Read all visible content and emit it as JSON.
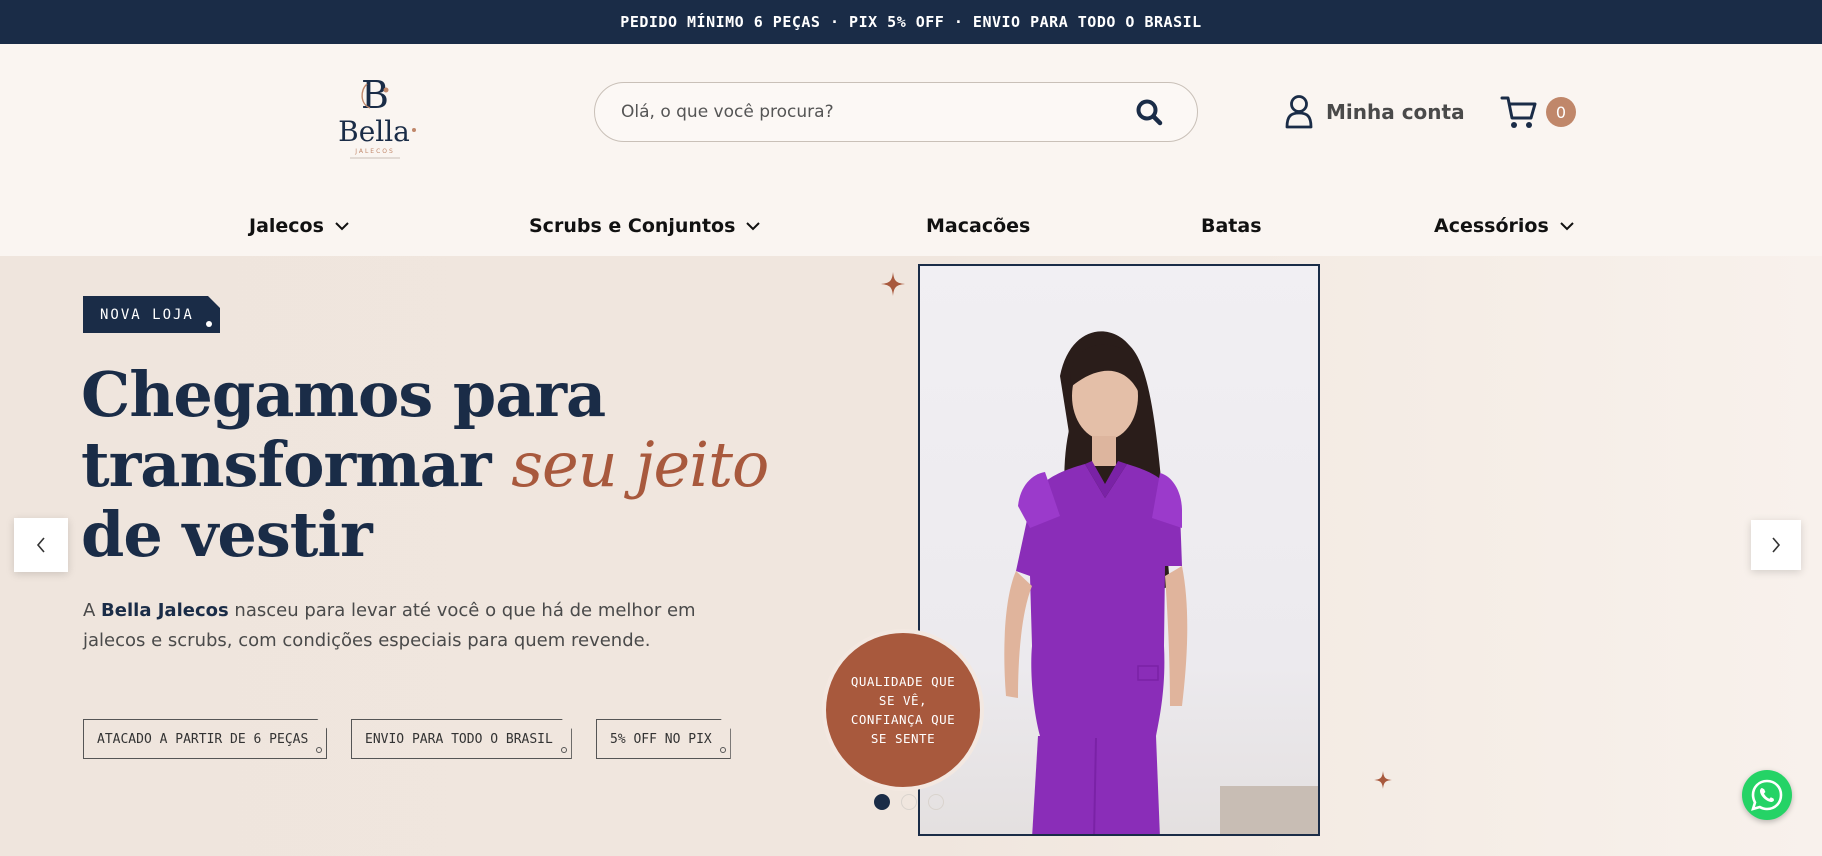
{
  "topbar": {
    "text": "PEDIDO MÍNIMO 6 PEÇAS · PIX 5% OFF · ENVIO PARA TODO O BRASIL"
  },
  "header": {
    "logo": {
      "name": "Bella",
      "sub": "JALECOS"
    },
    "search": {
      "placeholder": "Olá, o que você procura?"
    },
    "account_label": "Minha conta",
    "cart_count": "0"
  },
  "nav": {
    "items": [
      {
        "label": "Jalecos",
        "dropdown": true
      },
      {
        "label": "Scrubs e Conjuntos",
        "dropdown": true
      },
      {
        "label": "Macacões",
        "dropdown": false
      },
      {
        "label": "Batas",
        "dropdown": false
      },
      {
        "label": "Acessórios",
        "dropdown": true
      }
    ]
  },
  "hero": {
    "tag": "NOVA LOJA",
    "headline_1": "Chegamos para",
    "headline_2a": "transformar ",
    "headline_2b": "seu jeito",
    "headline_3": "de vestir",
    "desc_pre": "A ",
    "desc_brand": "Bella Jalecos",
    "desc_post": " nasceu para levar até você o que há de melhor em jalecos e scrubs, com condições especiais para quem revende.",
    "chips": [
      "ATACADO A PARTIR DE 6 PEÇAS",
      "ENVIO PARA TODO O BRASIL",
      "5% OFF NO PIX"
    ],
    "seal": "QUALIDADE QUE SE VÊ, CONFIANÇA QUE SE SENTE",
    "slides_total": 3,
    "slide_active": 1
  },
  "colors": {
    "navy": "#1a2c47",
    "terracotta": "#a8593d",
    "cart_badge": "#c0876a",
    "whatsapp": "#25d366",
    "scrub_purple": "#8a2db8"
  },
  "icons": [
    "user-icon",
    "cart-icon",
    "search-icon",
    "chevron-down-icon",
    "chevron-left-icon",
    "chevron-right-icon",
    "whatsapp-icon",
    "sparkle-icon"
  ]
}
